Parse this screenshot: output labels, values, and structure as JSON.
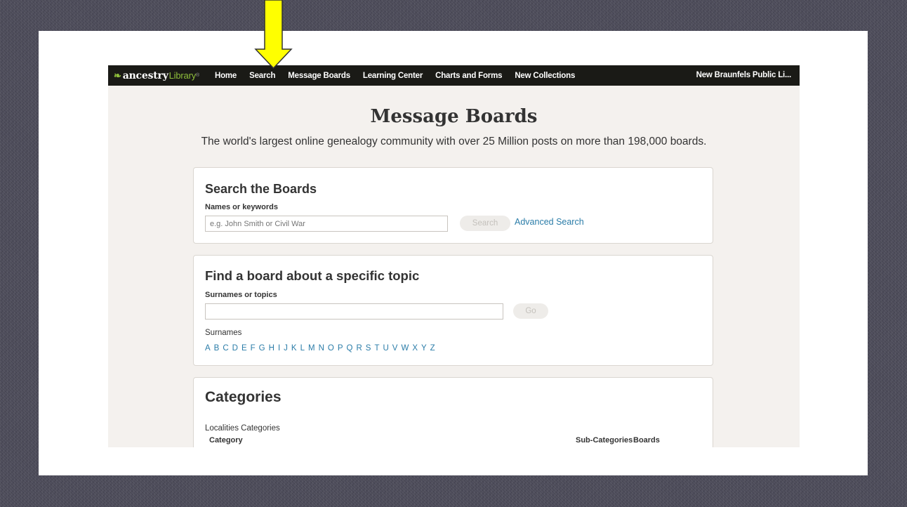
{
  "navbar": {
    "brand": "ancestry",
    "brand_sub": "Library",
    "trademark": "®",
    "items": [
      "Home",
      "Search",
      "Message Boards",
      "Learning Center",
      "Charts and Forms",
      "New Collections"
    ],
    "library_name": "New Braunfels Public Li..."
  },
  "hero": {
    "title": "Message Boards",
    "subtitle": "The world's largest online genealogy community with over 25 Million posts on more than 198,000 boards."
  },
  "search_boards": {
    "heading": "Search the Boards",
    "label": "Names or keywords",
    "placeholder": "e.g. John Smith or Civil War",
    "button": "Search",
    "advanced_link": "Advanced Search"
  },
  "find_board": {
    "heading": "Find a board about a specific topic",
    "label": "Surnames or topics",
    "placeholder": "",
    "button": "Go",
    "surnames_label": "Surnames",
    "letters": [
      "A",
      "B",
      "C",
      "D",
      "E",
      "F",
      "G",
      "H",
      "I",
      "J",
      "K",
      "L",
      "M",
      "N",
      "O",
      "P",
      "Q",
      "R",
      "S",
      "T",
      "U",
      "V",
      "W",
      "X",
      "Y",
      "Z"
    ]
  },
  "categories": {
    "heading": "Categories",
    "subheading": "Localities Categories",
    "columns": [
      "Category",
      "Sub-Categories",
      "Boards"
    ]
  },
  "colors": {
    "navbar_bg": "#1a1a16",
    "brand_green": "#8fbf3b",
    "link_blue": "#2a7ca8",
    "page_bg": "#f4f1ee",
    "arrow_fill": "#ffff00",
    "slide_bg": "#4d4c5a"
  }
}
